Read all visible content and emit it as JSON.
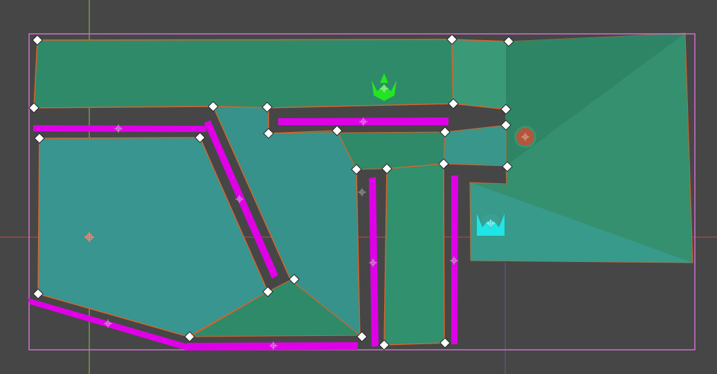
{
  "editor": {
    "view": "2d-navigation-polygon-editor",
    "colors": {
      "background": "#464646",
      "bounds_outline": "#d070d0",
      "nav_region_dark": "#2f8a6a",
      "nav_region_light": "#3a9f8c",
      "nav_region_teal": "#38958f",
      "region_outline": "#d9642c",
      "wall_collision": "#e000e8",
      "vertex_handle": "#ffffff",
      "origin_axis_x": "#c24848",
      "origin_axis_y": "#8ac84c",
      "enemy_green": "#22e622",
      "enemy_cyan": "#1ee6e6",
      "waypoint_brown": "#b0573c"
    },
    "icons": {
      "pivot": "pivot-crosshair-icon",
      "vertex": "vertex-diamond-icon",
      "enemy_green": "green-enemy-sprite-icon",
      "enemy_cyan": "cyan-enemy-sprite-icon",
      "waypoint": "waypoint-circle-icon"
    }
  }
}
